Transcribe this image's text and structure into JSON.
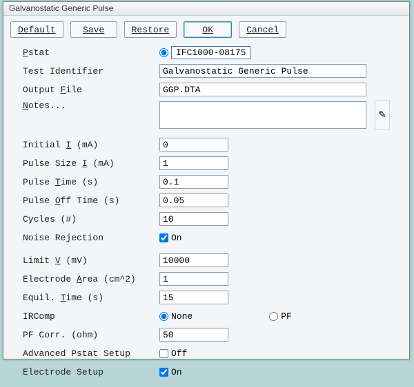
{
  "window": {
    "title": "Galvanostatic Generic Pulse"
  },
  "toolbar": {
    "default": "Default",
    "save": "Save",
    "restore": "Restore",
    "ok": "OK",
    "cancel": "Cancel"
  },
  "labels": {
    "pstat": "Pstat",
    "test_id": "Test Identifier",
    "output_file": "Output File",
    "notes": "Notes...",
    "initial_i": "Initial I (mA)",
    "pulse_size_i": "Pulse Size I (mA)",
    "pulse_time": "Pulse Time (s)",
    "pulse_off_time": "Pulse Off Time (s)",
    "cycles": "Cycles (#)",
    "noise_rej": "Noise Rejection",
    "limit_v": "Limit V (mV)",
    "elec_area": "Electrode Area (cm^2)",
    "equil_time": "Equil. Time (s)",
    "ircomp": "IRComp",
    "pf_corr": "PF Corr. (ohm)",
    "adv_pstat": "Advanced Pstat Setup",
    "elec_setup": "Electrode Setup"
  },
  "values": {
    "pstat_name": "IFC1000-08175",
    "test_id": "Galvanostatic Generic Pulse",
    "output_file": "GGP.DTA",
    "notes": "",
    "initial_i": "0",
    "pulse_size_i": "1",
    "pulse_time": "0.1",
    "pulse_off_time": "0.05",
    "cycles": "10",
    "noise_rej_on": true,
    "limit_v": "10000",
    "elec_area": "1",
    "equil_time": "15",
    "ircomp": "None",
    "pf_corr": "50",
    "adv_pstat_on": false,
    "elec_setup_on": true
  },
  "options": {
    "on": "On",
    "off": "Off",
    "ircomp_none": "None",
    "ircomp_pf": "PF"
  },
  "icons": {
    "notes_expand": "✎"
  }
}
